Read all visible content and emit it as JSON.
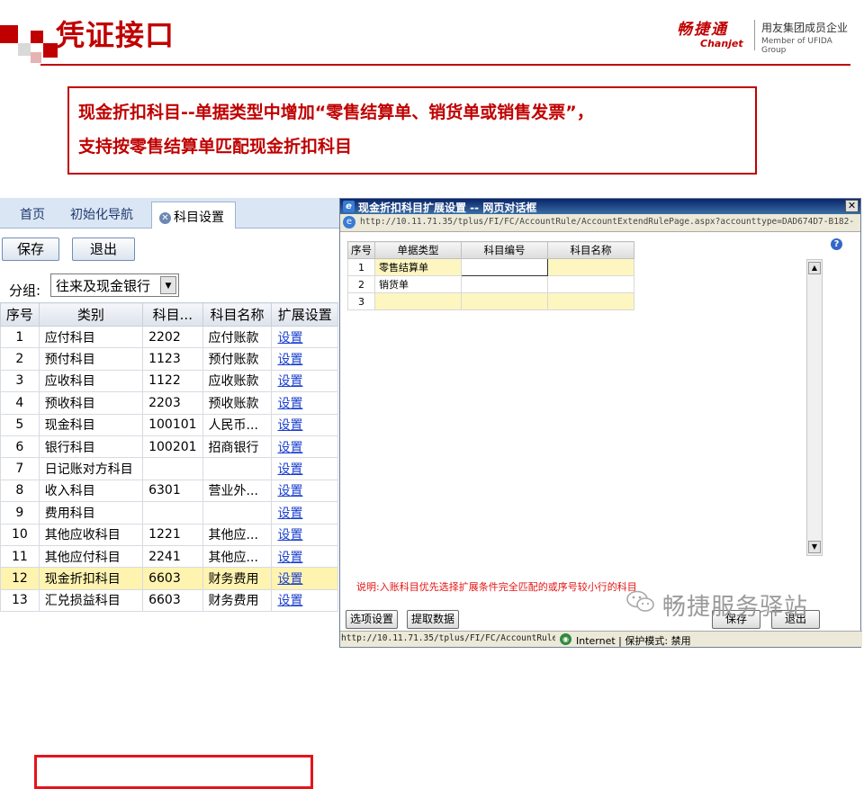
{
  "slide": {
    "title": "凭证接口",
    "brand": {
      "name": "畅捷通",
      "name_en": "Chanjet",
      "tagline": "用友集团成员企业",
      "tagline_en": "Member of UFIDA Group"
    },
    "callout": {
      "line1": "现金折扣科目--单据类型中增加“零售结算单、销货单或销售发票”，",
      "line2": "支持按零售结算单匹配现金折扣科目"
    },
    "watermark": "畅捷服务驿站",
    "colors": {
      "accent": "#c00000",
      "highlight_border": "#e3151b",
      "link": "#1a3fd0"
    }
  },
  "left_panel": {
    "tabs": [
      {
        "label": "首页"
      },
      {
        "label": "初始化导航"
      },
      {
        "label": "科目设置",
        "active": true,
        "icon": "close-icon"
      }
    ],
    "buttons": {
      "save": "保存",
      "exit": "退出"
    },
    "group": {
      "label": "分组:",
      "value": "往来及现金银行"
    },
    "columns": [
      "序号",
      "类别",
      "科目...",
      "科目名称",
      "扩展设置"
    ],
    "rows": [
      {
        "no": "1",
        "category": "应付科目",
        "code": "2202",
        "name": "应付账款",
        "ext": "设置"
      },
      {
        "no": "2",
        "category": "预付科目",
        "code": "1123",
        "name": "预付账款",
        "ext": "设置"
      },
      {
        "no": "3",
        "category": "应收科目",
        "code": "1122",
        "name": "应收账款",
        "ext": "设置"
      },
      {
        "no": "4",
        "category": "预收科目",
        "code": "2203",
        "name": "预收账款",
        "ext": "设置"
      },
      {
        "no": "5",
        "category": "现金科目",
        "code": "100101",
        "name": "人民币...",
        "ext": "设置"
      },
      {
        "no": "6",
        "category": "银行科目",
        "code": "100201",
        "name": "招商银行",
        "ext": "设置"
      },
      {
        "no": "7",
        "category": "日记账对方科目",
        "code": "",
        "name": "",
        "ext": "设置"
      },
      {
        "no": "8",
        "category": "收入科目",
        "code": "6301",
        "name": "营业外...",
        "ext": "设置"
      },
      {
        "no": "9",
        "category": "费用科目",
        "code": "",
        "name": "",
        "ext": "设置"
      },
      {
        "no": "10",
        "category": "其他应收科目",
        "code": "1221",
        "name": "其他应...",
        "ext": "设置"
      },
      {
        "no": "11",
        "category": "其他应付科目",
        "code": "2241",
        "name": "其他应...",
        "ext": "设置"
      },
      {
        "no": "12",
        "category": "现金折扣科目",
        "code": "6603",
        "name": "财务费用",
        "ext": "设置",
        "highlighted": true
      },
      {
        "no": "13",
        "category": "汇兑损益科目",
        "code": "6603",
        "name": "财务费用",
        "ext": "设置"
      }
    ]
  },
  "dialog": {
    "title": "现金折扣科目扩展设置 -- 网页对话框",
    "url": "http://10.11.71.35/tplus/FI/FC/AccountRule/AccountExtendRulePage.aspx?accounttype=DAD674D7-B182-",
    "help_icon": "help-icon",
    "columns": [
      "序号",
      "单据类型",
      "科目编号",
      "科目名称"
    ],
    "rows": [
      {
        "no": "1",
        "type": "零售结算单",
        "code": "",
        "name": ""
      },
      {
        "no": "2",
        "type": "销货单",
        "code": "",
        "name": ""
      },
      {
        "no": "3",
        "type": "",
        "code": "",
        "name": ""
      }
    ],
    "note": "说明:入账科目优先选择扩展条件完全匹配的或序号较小行的科目",
    "buttons": {
      "options": "选项设置",
      "fetch": "提取数据",
      "save": "保存",
      "exit": "退出"
    },
    "status": {
      "url": "http://10.11.71.35/tplus/FI/FC/AccountRule",
      "zone": "Internet | 保护模式: 禁用"
    }
  }
}
